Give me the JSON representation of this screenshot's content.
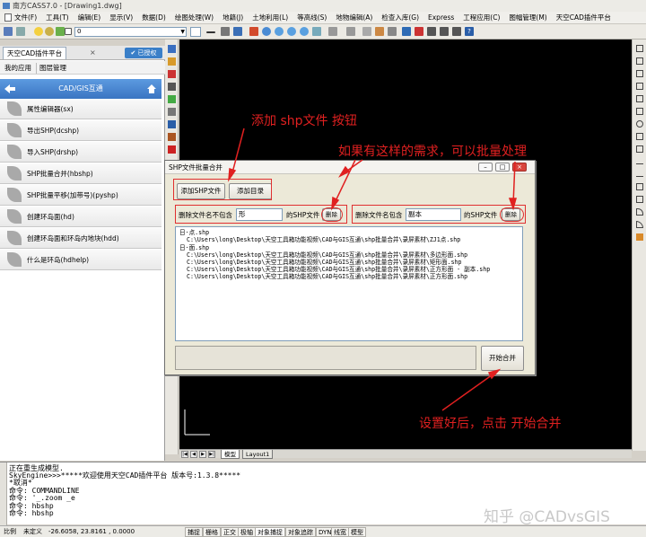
{
  "window": {
    "title": "南方CASS7.0 - [Drawing1.dwg]"
  },
  "menu": [
    "文件(F)",
    "工具(T)",
    "编辑(E)",
    "显示(V)",
    "数据(D)",
    "绘图处理(W)",
    "地籍(J)",
    "土地利用(L)",
    "等高线(S)",
    "地物编辑(A)",
    "检查入库(G)",
    "Express",
    "工程应用(C)",
    "图幅管理(M)",
    "天空CAD插件平台"
  ],
  "toolbar": {
    "layer_value": "0"
  },
  "panel": {
    "title": "天空CAD插件平台",
    "close": "×",
    "auth": "✔ 已授权",
    "tabs": [
      "我的应用",
      "图层管理"
    ],
    "category": "CAD/GIS互通",
    "items": [
      "属性编辑器(sx)",
      "导出SHP(dcshp)",
      "导入SHP(drshp)",
      "SHP批量合并(hbshp)",
      "SHP批量平移(加带号)(pyshp)",
      "创建环岛面(hd)",
      "创建环岛面和环岛内地块(hdd)",
      "什么是环岛(hdhelp)"
    ]
  },
  "dialog": {
    "title": "SHP文件批量合并",
    "add_file": "添加SHP文件",
    "add_dir": "添加目录",
    "exclude_label": "删除文件名不包含",
    "exclude_value": "形",
    "exclude_suffix": "的SHP文件",
    "include_label": "删除文件名包含",
    "include_value": "副本",
    "include_suffix": "的SHP文件",
    "delete_btn": "删除",
    "start_btn": "开始合并",
    "tree": [
      "日·点.shp",
      "   C:\\Users\\long\\Desktop\\天空工具箱功能视频\\CAD与GIS互通\\shp批量合并\\录屏素材\\ZJ1点.shp",
      "日·面.shp",
      "   C:\\Users\\long\\Desktop\\天空工具箱功能视频\\CAD与GIS互通\\shp批量合并\\录屏素材\\多边形面.shp",
      "   C:\\Users\\long\\Desktop\\天空工具箱功能视频\\CAD与GIS互通\\shp批量合并\\录屏素材\\矩形面.shp",
      "   C:\\Users\\long\\Desktop\\天空工具箱功能视频\\CAD与GIS互通\\shp批量合并\\录屏素材\\正方形面 - 副本.shp",
      "   C:\\Users\\long\\Desktop\\天空工具箱功能视频\\CAD与GIS互通\\shp批量合并\\录屏素材\\正方形面.shp"
    ]
  },
  "annotations": {
    "add_shp": "添加 shp文件 按钮",
    "batch": "如果有这样的需求，可以批量处理",
    "start": "设置好后，点击 开始合并"
  },
  "layout_tabs": [
    "模型",
    "Layout1"
  ],
  "command": [
    "正在重生成模型.",
    "SkyEngine>>>*****欢迎使用天空CAD插件平台 版本号:1.3.8*****",
    "*取消*",
    "命令: COMMANDLINE",
    "命令: '_.zoom _e",
    "命令: hbshp",
    "命令: hbshp"
  ],
  "watermark": "知乎 @CADvsGIS",
  "status": {
    "scale": "比例",
    "scale_value": "未定义",
    "coords": "-26.6058, 23.8161 , 0.0000",
    "toggles": [
      "捕捉",
      "栅格",
      "正交",
      "极轴",
      "对象捕捉",
      "对象追踪",
      "DYN",
      "线宽",
      "模型"
    ]
  },
  "colors": {
    "annotation": "#e02020",
    "panel_accent": "#3a75c2",
    "canvas": "#000000"
  }
}
